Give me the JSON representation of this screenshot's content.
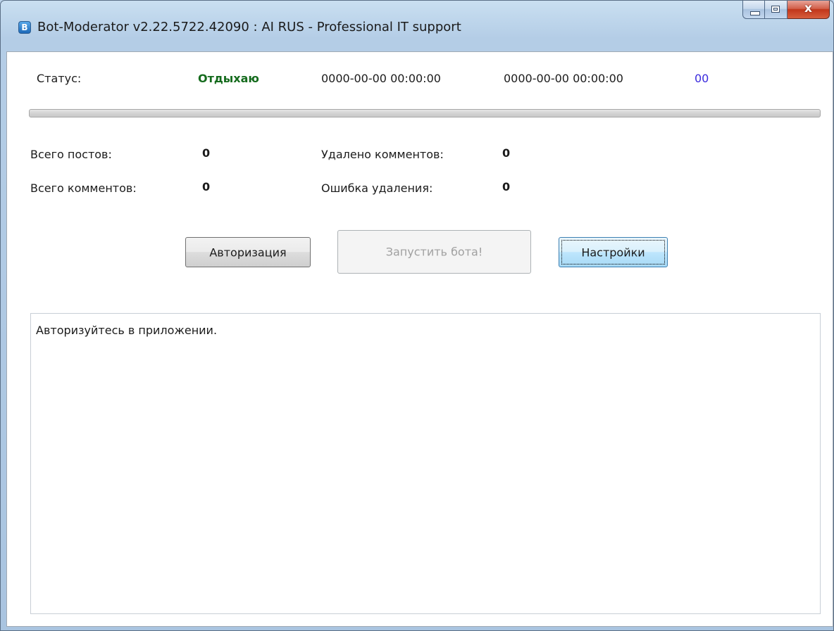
{
  "window": {
    "title": "Bot-Moderator v2.22.5722.42090 : AI RUS - Professional IT support",
    "icon": "bot-moderator-app-icon",
    "close_glyph": "x"
  },
  "status": {
    "label": "Статус:",
    "value": "Отдыхаю",
    "date_start": "0000-00-00 00:00:00",
    "date_end": "0000-00-00 00:00:00",
    "counter": "00",
    "value_color": "#156b1d",
    "counter_color": "#3b2bdd"
  },
  "progress": {
    "value": 0
  },
  "stats": {
    "posts_label": "Всего постов:",
    "posts_value": "0",
    "comments_label": "Всего комментов:",
    "comments_value": "0",
    "deleted_label": "Удалено комментов:",
    "deleted_value": "0",
    "errors_label": "Ошибка удаления:",
    "errors_value": "0"
  },
  "buttons": {
    "auth_label": "Авторизация",
    "start_label": "Запустить бота!",
    "settings_label": "Настройки"
  },
  "log": {
    "text": "Авторизуйтесь в приложении."
  }
}
